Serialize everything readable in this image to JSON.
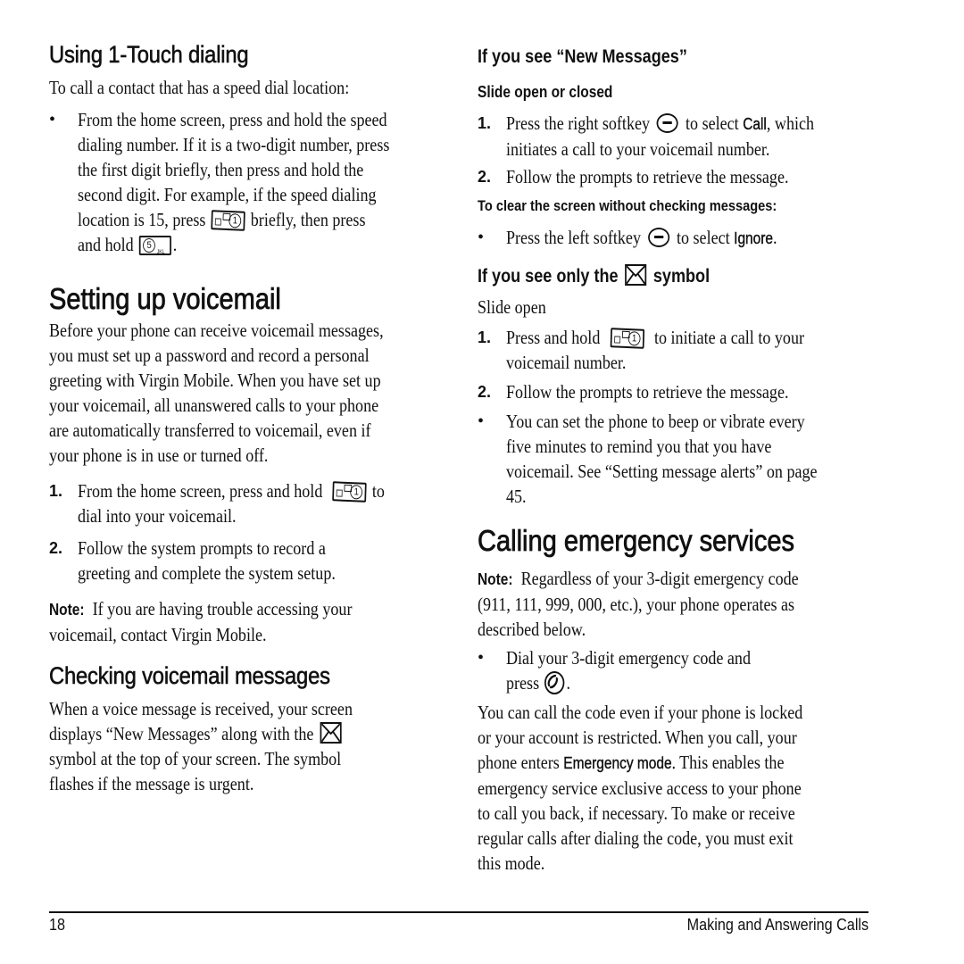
{
  "left_column": {
    "one_touch": {
      "heading": "Using 1-Touch dialing",
      "intro": "To call a contact that has a speed dial location:",
      "bullet": {
        "marker": "•",
        "text_a": "From the home screen, press and hold the speed dialing number. If it is a two-digit number, press the first digit briefly, then press and hold the second digit. For example, if the speed dialing location is 15, press",
        "text_b": "briefly, then press and hold",
        "text_c": "."
      }
    },
    "setup_voicemail": {
      "heading": "Setting up voicemail",
      "body": "Before your phone can receive voicemail messages, you must set up a password and record a personal greeting with Virgin Mobile. When you have set up your voicemail, all unanswered calls to your phone are automatically transferred to voicemail, even if your phone is in use or turned off.",
      "steps": [
        {
          "marker": "1.",
          "text_a": "From the home screen, press and hold",
          "text_b": "to dial into your voicemail."
        },
        {
          "marker": "2.",
          "text": "Follow the system prompts to record a greeting and complete the system setup."
        }
      ],
      "note_label": "Note:",
      "note_text": "If you are having trouble accessing your voicemail, contact Virgin Mobile."
    },
    "checking": {
      "heading": "Checking voicemail messages",
      "body_a": "When a voice message is received, your screen displays “New Messages” along with the",
      "body_b": "symbol at the top of your screen. The symbol flashes if the message is urgent."
    }
  },
  "right_column": {
    "new_messages": {
      "heading": "If you see “New Messages”",
      "subheading": "Slide open or closed",
      "steps": [
        {
          "marker": "1.",
          "text_a": "Press the right softkey",
          "text_b": "to select",
          "bold": "Call",
          "text_c": ", which initiates a call to your voicemail number."
        },
        {
          "marker": "2.",
          "text": "Follow the prompts to retrieve the message."
        }
      ],
      "clear_label": "To clear the screen without checking messages:",
      "clear_bullet": {
        "marker": "•",
        "text_a": "Press the left softkey",
        "text_b": "to select",
        "bold": "Ignore",
        "text_c": "."
      }
    },
    "only_symbol": {
      "heading_a": "If you see only the",
      "heading_b": "symbol",
      "slide": "Slide open",
      "steps": [
        {
          "marker": "1.",
          "text_a": "Press and hold",
          "text_b": "to initiate a call to your voicemail number."
        },
        {
          "marker": "2.",
          "text": "Follow the prompts to retrieve the message."
        }
      ],
      "bullet": {
        "marker": "•",
        "text": "You can set the phone to beep or vibrate every five minutes to remind you that you have voicemail. See “Setting message alerts” on page 45."
      }
    },
    "emergency": {
      "heading": "Calling emergency services",
      "note_label": "Note:",
      "note_text": "Regardless of your 3-digit emergency code (911, 111, 999, 000, etc.), your phone operates as described below.",
      "bullet": {
        "marker": "•",
        "text_a": "Dial your 3-digit emergency code and press",
        "text_b": "."
      },
      "body_a": "You can call the code even if your phone is locked or your account is restricted. When you call, your phone enters",
      "body_bold": "Emergency mode.",
      "body_b": "This enables the emergency service exclusive access to your phone to call you back, if necessary. To make or receive regular calls after dialing the code, you must exit this mode."
    }
  },
  "footer": {
    "page_number": "18",
    "chapter_title": "Making and Answering Calls"
  },
  "keys": {
    "key_1_digit": "1",
    "key_5_digit": "5",
    "key_5_letters": "JKL"
  }
}
